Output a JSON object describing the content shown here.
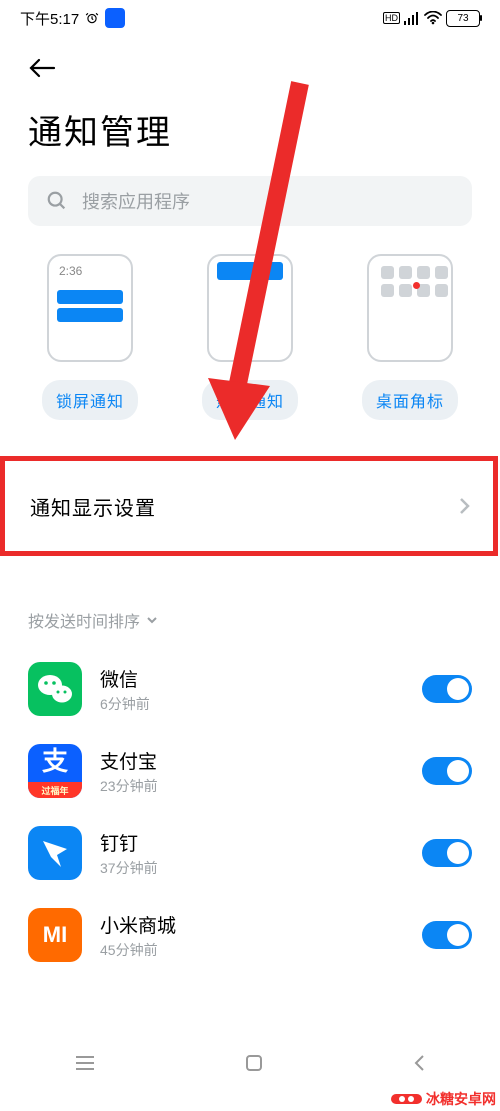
{
  "status": {
    "time": "下午5:17",
    "battery": "73"
  },
  "page_title": "通知管理",
  "search": {
    "placeholder": "搜索应用程序"
  },
  "types": {
    "lock": {
      "label": "锁屏通知",
      "time_mock": "2:36"
    },
    "float": {
      "label": "悬浮通知"
    },
    "badge": {
      "label": "桌面角标"
    }
  },
  "setting_row": "通知显示设置",
  "sort_label": "按发送时间排序",
  "apps": [
    {
      "name": "微信",
      "time": "6分钟前"
    },
    {
      "name": "支付宝",
      "time": "23分钟前",
      "band": "过福年"
    },
    {
      "name": "钉钉",
      "time": "37分钟前"
    },
    {
      "name": "小米商城",
      "time": "45分钟前"
    }
  ],
  "watermark": "冰糖安卓网"
}
